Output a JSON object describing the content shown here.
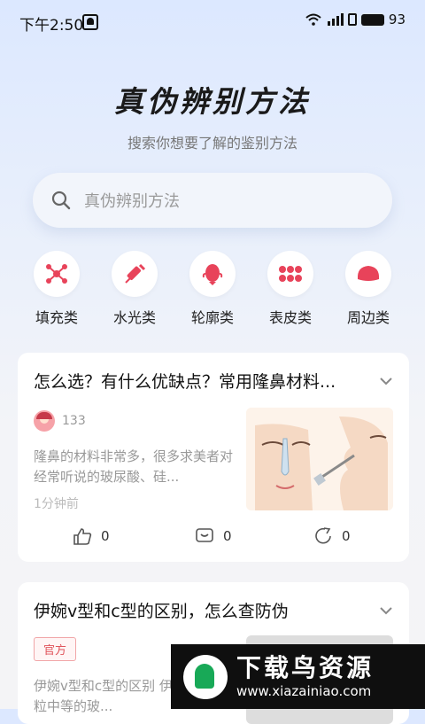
{
  "status_bar": {
    "time": "下午2:50",
    "battery": "93"
  },
  "hero": {
    "title": "真伪辨别方法",
    "subtitle": "搜索你想要了解的鉴别方法"
  },
  "search": {
    "placeholder": "真伪辨别方法"
  },
  "categories": [
    {
      "label": "填充类",
      "icon": "molecule-icon"
    },
    {
      "label": "水光类",
      "icon": "syringe-icon"
    },
    {
      "label": "轮廓类",
      "icon": "face-icon"
    },
    {
      "label": "表皮类",
      "icon": "dots-icon"
    },
    {
      "label": "周边类",
      "icon": "blob-icon"
    }
  ],
  "articles": [
    {
      "title": "怎么选？有什么优缺点？常用隆鼻材料...",
      "author": "133",
      "excerpt": "隆鼻的材料非常多，很多求美者对经常听说的玻尿酸、硅...",
      "time": "1分钟前",
      "likes": "0",
      "comments": "0",
      "shares": "0"
    },
    {
      "title": "伊婉v型和c型的区别，怎么查防伪",
      "badge": "官方",
      "excerpt": "伊婉v型和c型的区别 伊婉c型是颗粒中等的玻..."
    }
  ],
  "watermark": {
    "cn": "下载鸟资源",
    "en": "www.xiazainiao.com"
  },
  "colors": {
    "accent": "#e8435a",
    "badge": "#e0545b",
    "logo_green": "#18a957"
  }
}
